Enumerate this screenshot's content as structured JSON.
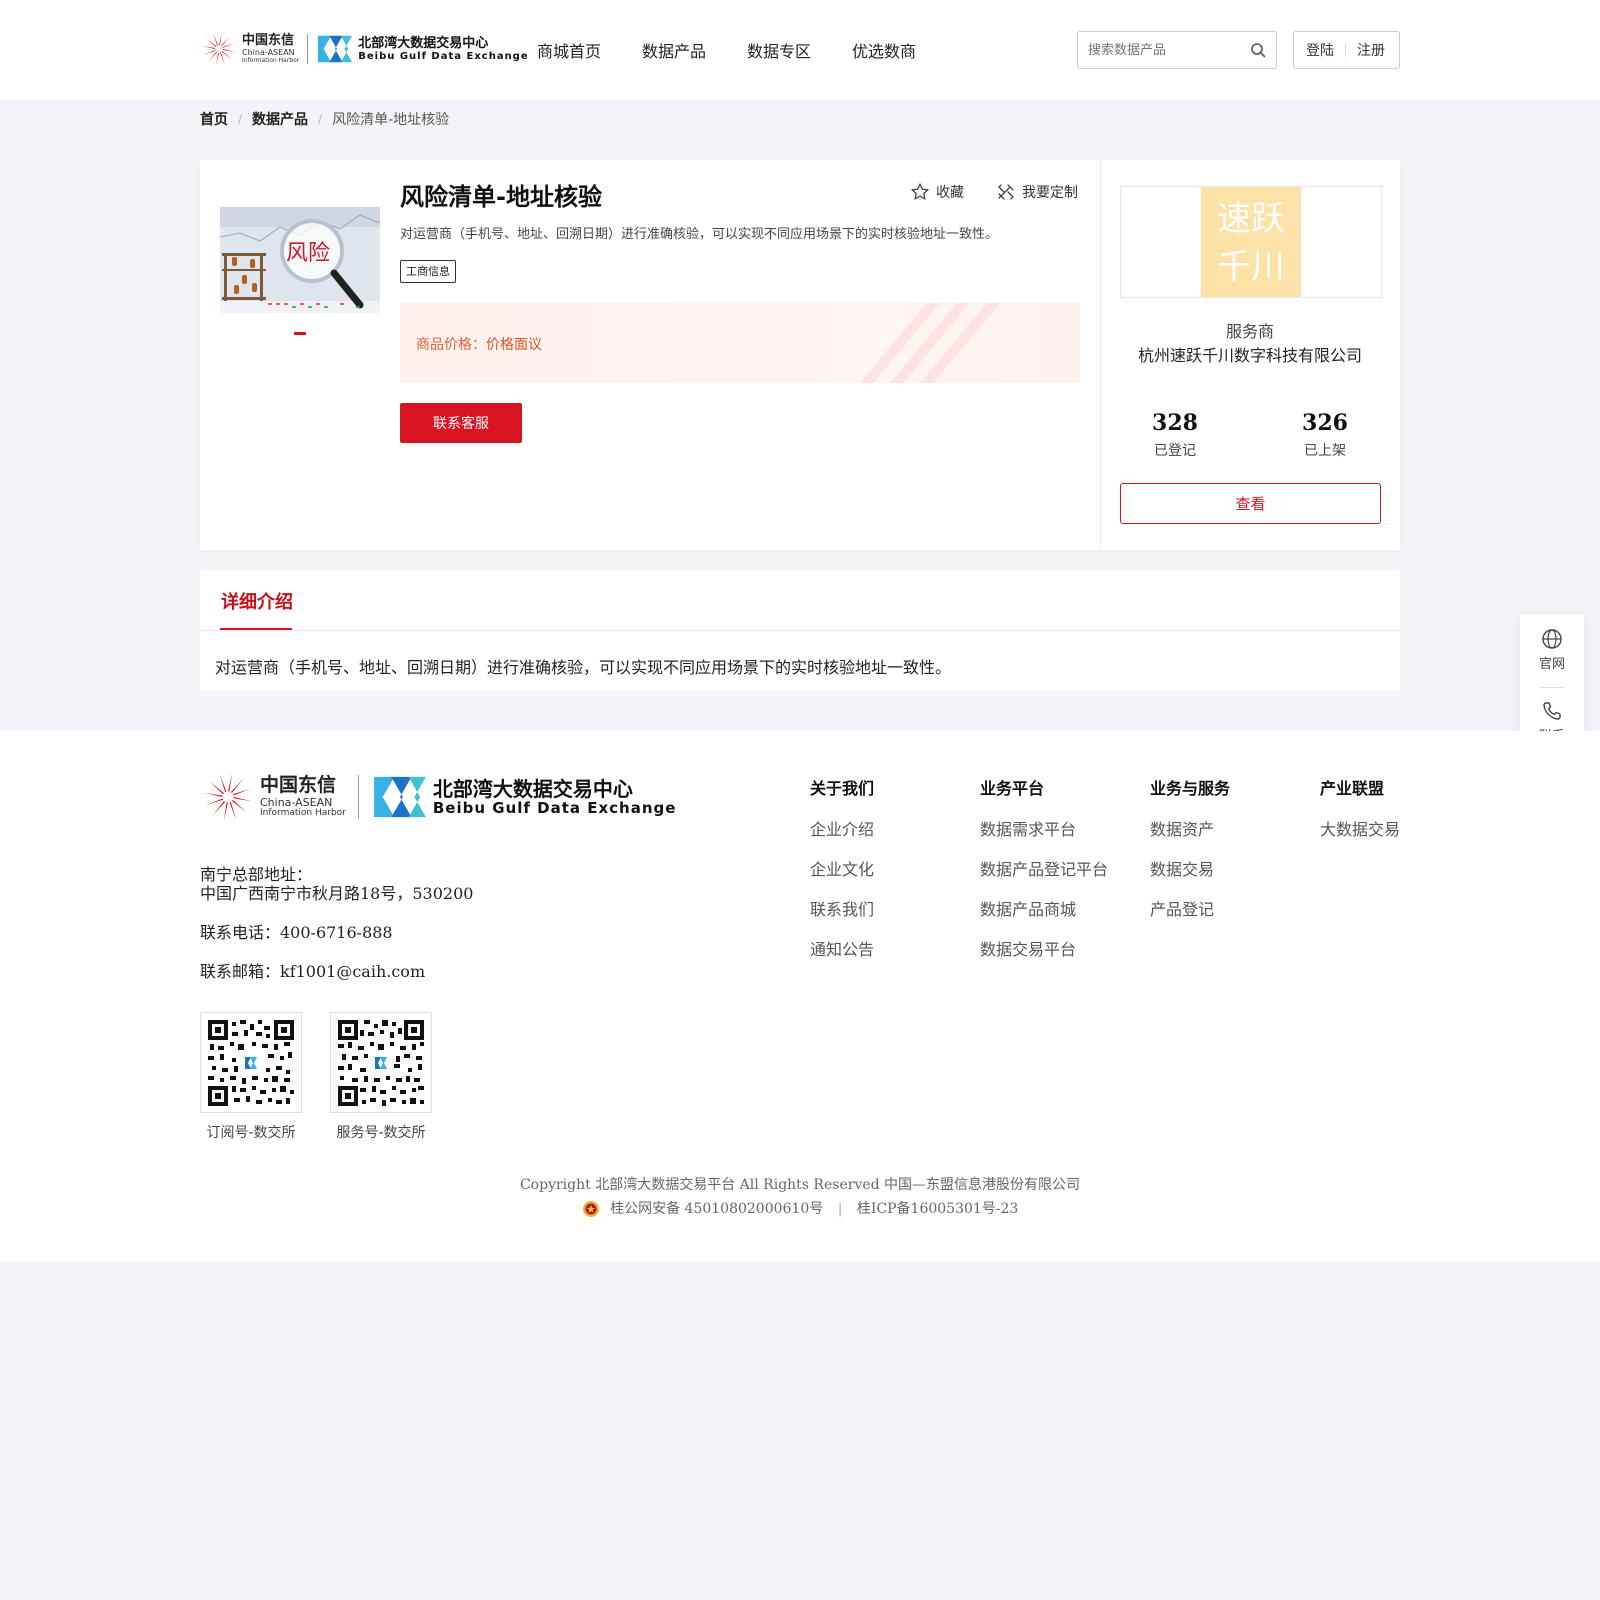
{
  "header": {
    "logo_cn": "中国东信",
    "logo_cn_en1": "China-ASEAN",
    "logo_cn_en2": "Information Harbor",
    "logo_bde": "北部湾大数据交易中心",
    "logo_bde_en": "Beibu Gulf Data Exchange",
    "nav": [
      "商城首页",
      "数据产品",
      "数据专区",
      "优选数商"
    ],
    "search_placeholder": "搜索数据产品",
    "login": "登陆",
    "register": "注册"
  },
  "breadcrumb": [
    "首页",
    "数据产品",
    "风险清单-地址核验"
  ],
  "product": {
    "image_text": "风险",
    "title": "风险清单-地址核验",
    "favorite": "收藏",
    "customize": "我要定制",
    "description": "对运营商（手机号、地址、回溯日期）进行准确核验，可以实现不同应用场景下的实时核验地址一致性。",
    "tag": "工商信息",
    "price_label": "商品价格：",
    "price_value": "价格面议",
    "contact_button": "联系客服"
  },
  "provider": {
    "logo_line1": "速跃",
    "logo_line2": "千川",
    "role": "服务商",
    "name": "杭州速跃千川数字科技有限公司",
    "stats": [
      {
        "value": "328",
        "label": "已登记"
      },
      {
        "value": "326",
        "label": "已上架"
      }
    ],
    "view_button": "查看"
  },
  "detail": {
    "tab": "详细介绍",
    "text": "对运营商（手机号、地址、回溯日期）进行准确核验，可以实现不同应用场景下的实时核验地址一致性。"
  },
  "float_bar": {
    "website": "官网",
    "contact": "联系"
  },
  "footer": {
    "address_label": "南宁总部地址：",
    "address": "中国广西南宁市秋月路18号，530200",
    "phone": "联系电话：400-6716-888",
    "email": "联系邮箱：kf1001@caih.com",
    "qr_codes": [
      "订阅号-数交所",
      "服务号-数交所"
    ],
    "columns": [
      {
        "title": "关于我们",
        "links": [
          "企业介绍",
          "企业文化",
          "联系我们",
          "通知公告"
        ]
      },
      {
        "title": "业务平台",
        "links": [
          "数据需求平台",
          "数据产品登记平台",
          "数据产品商城",
          "数据交易平台"
        ]
      },
      {
        "title": "业务与服务",
        "links": [
          "数据资产",
          "数据交易",
          "产品登记"
        ]
      },
      {
        "title": "产业联盟",
        "links": [
          "大数据交易"
        ]
      }
    ],
    "copyright": "Copyright 北部湾大数据交易平台 All Rights Reserved 中国—东盟信息港股份有限公司",
    "police_record": "桂公网安备 45010802000610号",
    "icp_record": "桂ICP备16005301号-23"
  },
  "colors": {
    "brand_red": "#d7141f",
    "price_orange": "#e04e22",
    "provider_logo_bg": "#fde2a8"
  }
}
